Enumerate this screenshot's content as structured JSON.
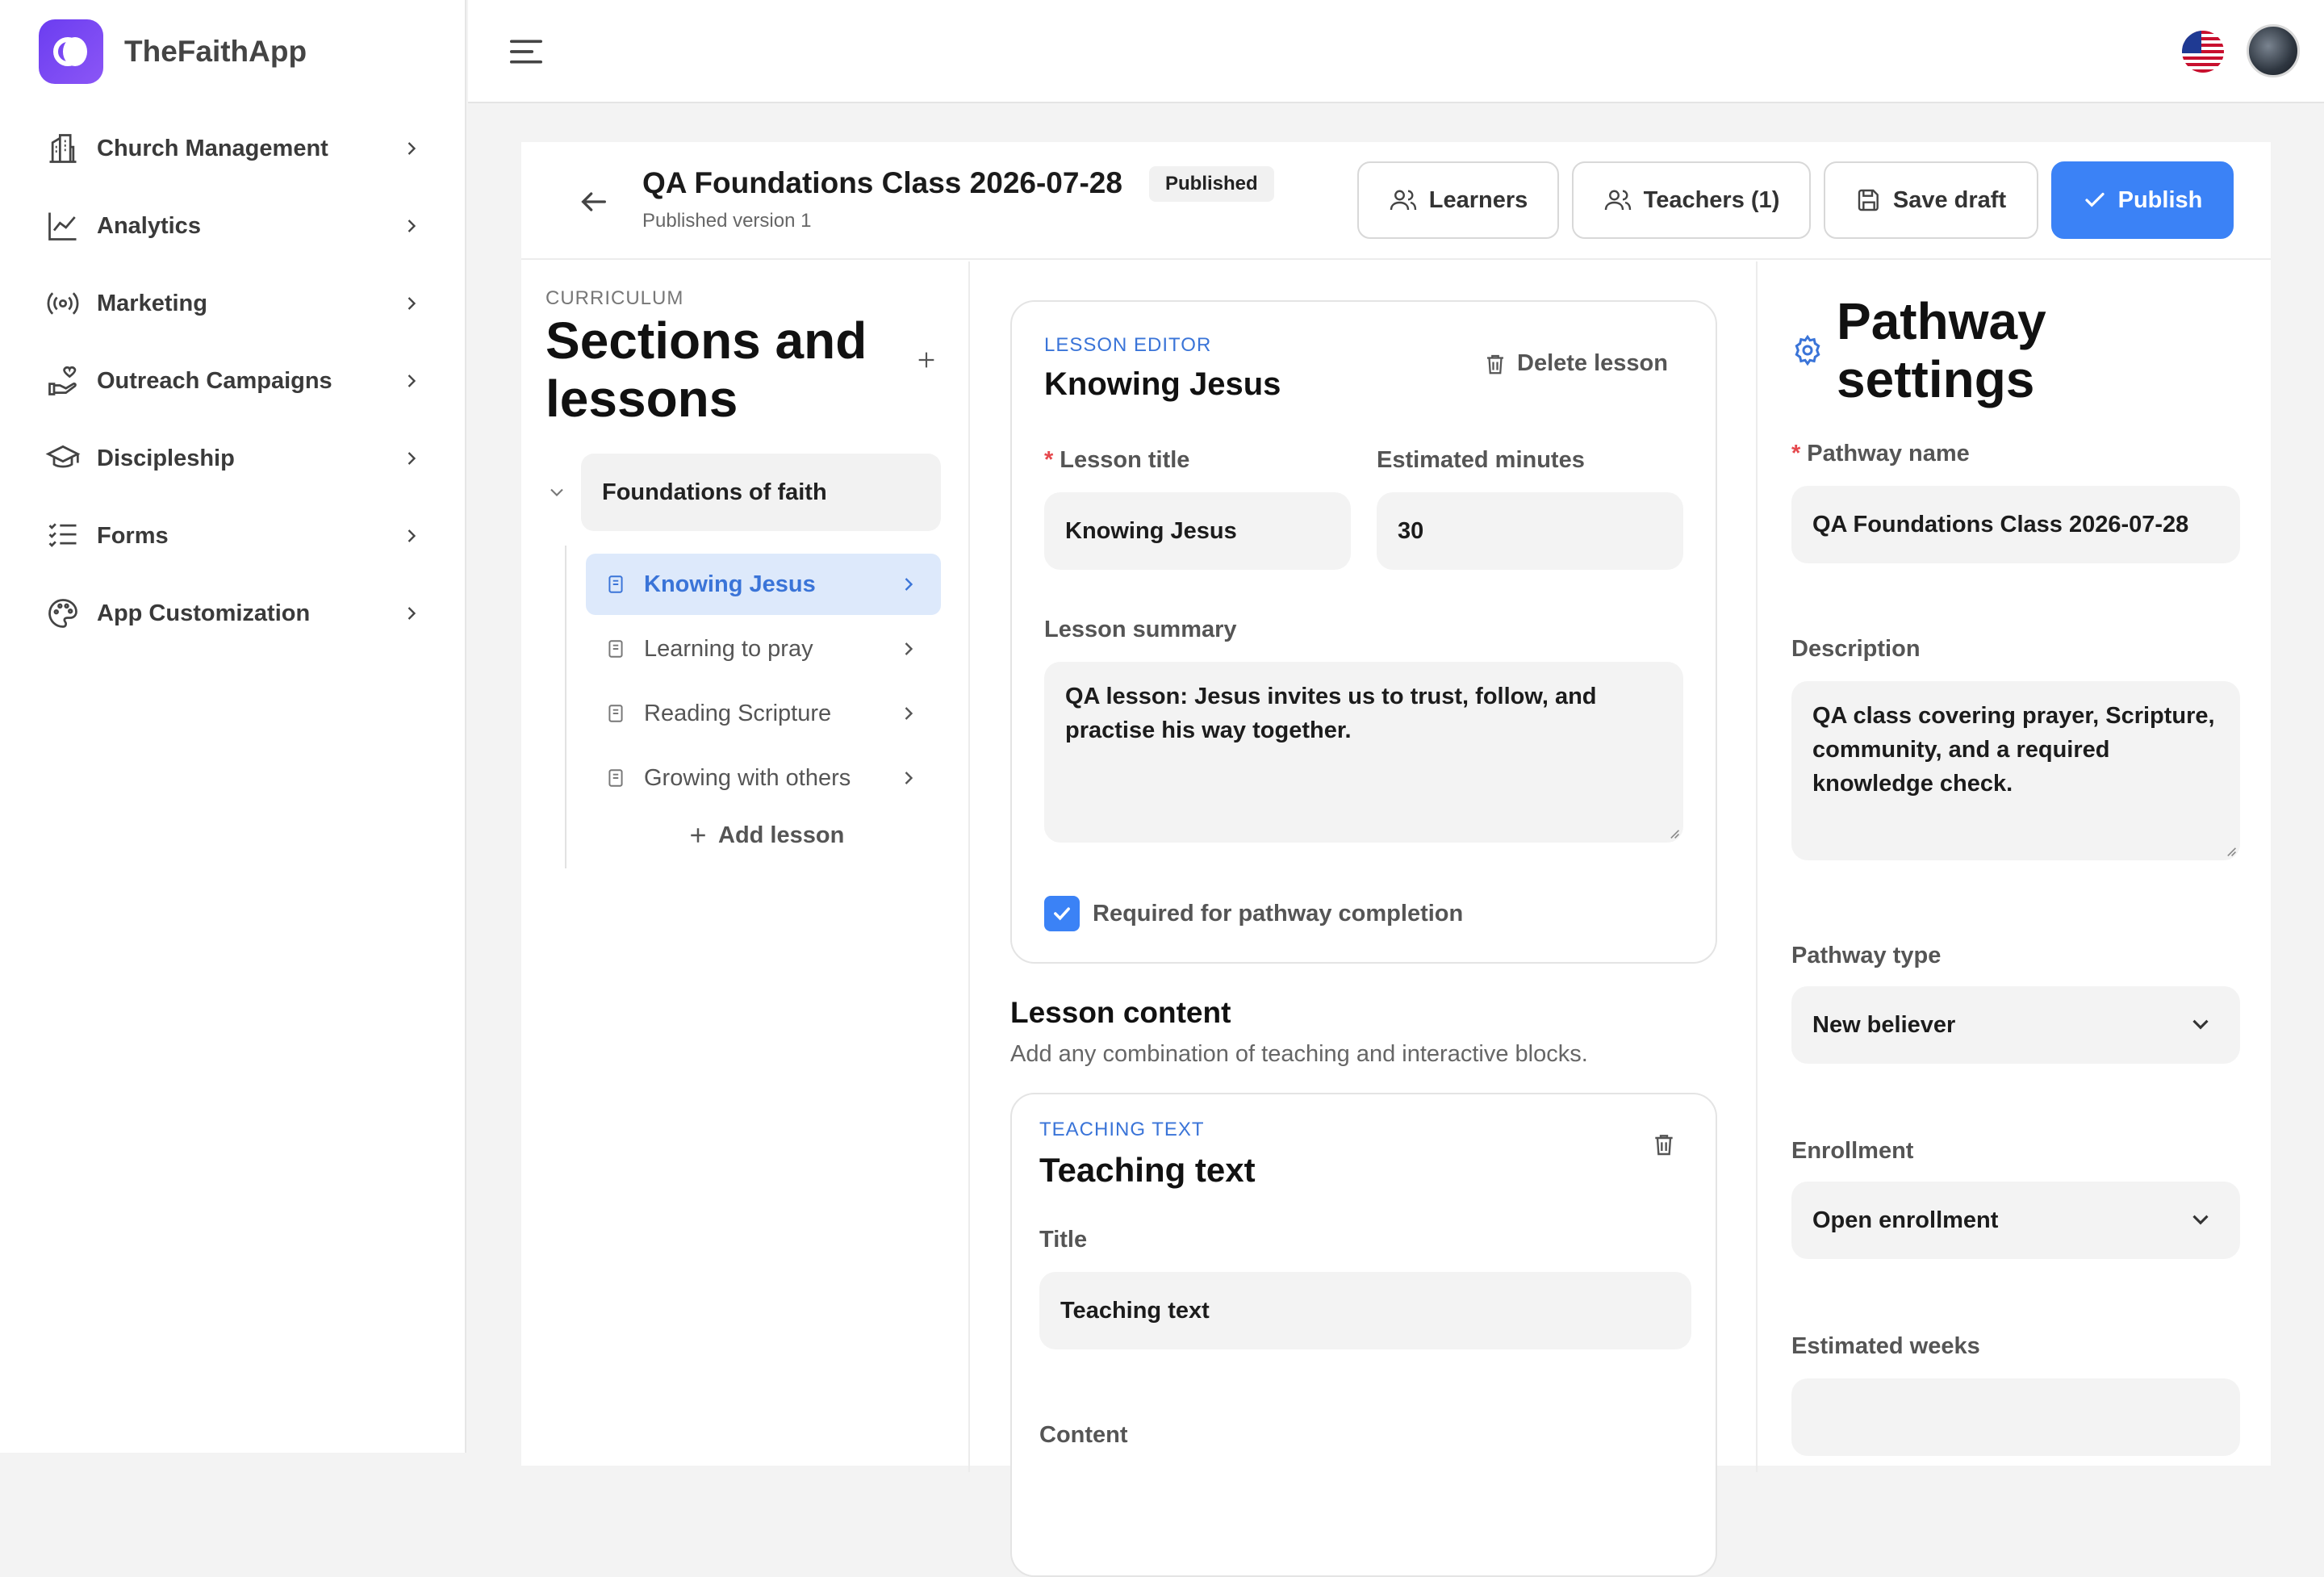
{
  "app": {
    "name": "TheFaithApp"
  },
  "sidebar": {
    "items": [
      {
        "label": "Church Management",
        "icon": "building-icon"
      },
      {
        "label": "Analytics",
        "icon": "chart-line-icon"
      },
      {
        "label": "Marketing",
        "icon": "broadcast-icon"
      },
      {
        "label": "Outreach Campaigns",
        "icon": "hand-heart-icon"
      },
      {
        "label": "Discipleship",
        "icon": "graduation-cap-icon"
      },
      {
        "label": "Forms",
        "icon": "list-check-icon"
      },
      {
        "label": "App Customization",
        "icon": "palette-icon"
      }
    ]
  },
  "header": {
    "title": "QA Foundations Class 2026-07-28",
    "status_badge": "Published",
    "subtitle": "Published version 1",
    "learners_label": "Learners",
    "teachers_label": "Teachers (1)",
    "save_draft_label": "Save draft",
    "publish_label": "Publish"
  },
  "curriculum": {
    "eyebrow": "CURRICULUM",
    "title": "Sections and lessons",
    "section": {
      "title": "Foundations of faith"
    },
    "lessons": [
      {
        "title": "Knowing Jesus",
        "active": true
      },
      {
        "title": "Learning to pray",
        "active": false
      },
      {
        "title": "Reading Scripture",
        "active": false
      },
      {
        "title": "Growing with others",
        "active": false
      }
    ],
    "add_lesson_label": "Add lesson"
  },
  "lesson_editor": {
    "eyebrow": "LESSON EDITOR",
    "title": "Knowing Jesus",
    "delete_label": "Delete lesson",
    "lesson_title_label": "Lesson title",
    "lesson_title_value": "Knowing Jesus",
    "minutes_label": "Estimated minutes",
    "minutes_value": "30",
    "summary_label": "Lesson summary",
    "summary_value": "QA lesson: Jesus invites us to trust, follow, and practise his way together.",
    "required_label": "Required for pathway completion",
    "required_checked": true
  },
  "lesson_content": {
    "title": "Lesson content",
    "subtitle": "Add any combination of teaching and interactive blocks.",
    "block": {
      "eyebrow": "TEACHING TEXT",
      "title": "Teaching text",
      "title_field_label": "Title",
      "title_field_value": "Teaching text",
      "content_label": "Content"
    }
  },
  "pathway_settings": {
    "title": "Pathway settings",
    "name_label": "Pathway name",
    "name_value": "QA Foundations Class 2026-07-28",
    "description_label": "Description",
    "description_value": "QA class covering prayer, Scripture, community, and a required knowledge check.",
    "type_label": "Pathway type",
    "type_value": "New believer",
    "enrollment_label": "Enrollment",
    "enrollment_value": "Open enrollment",
    "weeks_label": "Estimated weeks",
    "weeks_value": ""
  },
  "colors": {
    "accent": "#3b82f6",
    "brand": "#6b3df0",
    "active_bg": "#dde9fb",
    "required": "#e5484d"
  }
}
